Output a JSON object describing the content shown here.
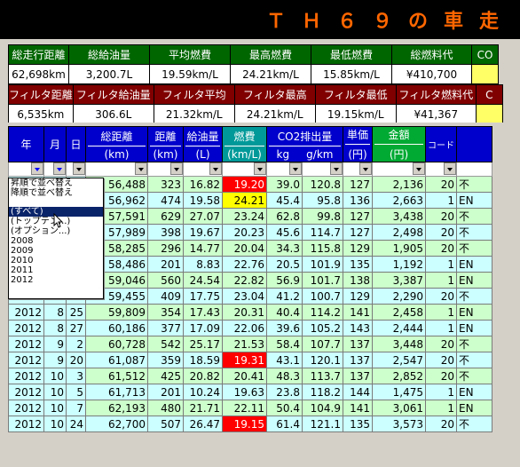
{
  "title": "ＴＨ６９の車走",
  "summary1": {
    "headers": [
      "総走行距離",
      "総給油量",
      "平均燃費",
      "最高燃費",
      "最低燃費",
      "総燃料代",
      "CO"
    ],
    "values": [
      "62,698km",
      "3,200.7L",
      "19.59km/L",
      "24.21km/L",
      "15.85km/L",
      "¥410,700",
      ""
    ]
  },
  "summary2": {
    "headers": [
      "フィルタ距離",
      "フィルタ給油量",
      "フィルタ平均",
      "フィルタ最高",
      "フィルタ最低",
      "フィルタ燃料代",
      "C"
    ],
    "values": [
      "6,535km",
      "306.6L",
      "21.32km/L",
      "24.21km/L",
      "19.15km/L",
      "¥41,367",
      ""
    ]
  },
  "headers": {
    "year": "年",
    "month": "月",
    "day": "日",
    "dist1": "総距離",
    "dist2": "(km)",
    "kyori1": "距離",
    "kyori2": "(km)",
    "fuel1": "給油量",
    "fuel2": "(L)",
    "eco1": "燃費",
    "eco2": "(km/L)",
    "co2": "CO2排出量",
    "co2a": "kg",
    "co2b": "g/km",
    "price1": "単価",
    "price2": "(円)",
    "amount1": "金額",
    "amount2": "(円)",
    "code": "コード"
  },
  "filter_popup": {
    "items": [
      "昇順で並べ替え",
      "降順で並べ替え",
      "(すべて)",
      "(トップテン...)",
      "(オプション...)",
      "2008",
      "2009",
      "2010",
      "2011",
      "2012"
    ],
    "selected_index": 2
  },
  "rows": [
    {
      "y": "",
      "m": "",
      "d": "",
      "total": "56,488",
      "dist": "323",
      "fuel": "16.82",
      "eco": "19.20",
      "kg": "39.0",
      "gkm": "120.8",
      "price": "127",
      "amt": "2,136",
      "code": "20",
      "st": "不",
      "hl": "red"
    },
    {
      "y": "",
      "m": "",
      "d": "",
      "total": "56,962",
      "dist": "474",
      "fuel": "19.58",
      "eco": "24.21",
      "kg": "45.4",
      "gkm": "95.8",
      "price": "136",
      "amt": "2,663",
      "code": "1",
      "st": "EN",
      "hl": "yel"
    },
    {
      "y": "",
      "m": "",
      "d": "",
      "total": "57,591",
      "dist": "629",
      "fuel": "27.07",
      "eco": "23.24",
      "kg": "62.8",
      "gkm": "99.8",
      "price": "127",
      "amt": "3,438",
      "code": "20",
      "st": "不",
      "hl": ""
    },
    {
      "y": "",
      "m": "",
      "d": "",
      "total": "57,989",
      "dist": "398",
      "fuel": "19.67",
      "eco": "20.23",
      "kg": "45.6",
      "gkm": "114.7",
      "price": "127",
      "amt": "2,498",
      "code": "20",
      "st": "不",
      "hl": ""
    },
    {
      "y": "",
      "m": "",
      "d": "",
      "total": "58,285",
      "dest": "",
      "dist": "296",
      "fuel": "14.77",
      "eco": "20.04",
      "kg": "34.3",
      "gkm": "115.8",
      "price": "129",
      "amt": "1,905",
      "code": "20",
      "st": "不",
      "hl": ""
    },
    {
      "y": "",
      "m": "",
      "d": "",
      "total": "58,486",
      "dist": "201",
      "fuel": "8.83",
      "eco": "22.76",
      "kg": "20.5",
      "gkm": "101.9",
      "price": "135",
      "amt": "1,192",
      "code": "1",
      "st": "EN",
      "hl": ""
    },
    {
      "y": "",
      "m": "",
      "d": "",
      "total": "59,046",
      "dist": "560",
      "fuel": "24.54",
      "eco": "22.82",
      "kg": "56.9",
      "gkm": "101.7",
      "price": "138",
      "amt": "3,387",
      "code": "1",
      "st": "EN",
      "hl": ""
    },
    {
      "y": "2012",
      "m": "8",
      "d": "15",
      "total": "59,455",
      "dist": "409",
      "fuel": "17.75",
      "eco": "23.04",
      "kg": "41.2",
      "gkm": "100.7",
      "price": "129",
      "amt": "2,290",
      "code": "20",
      "st": "不",
      "hl": ""
    },
    {
      "y": "2012",
      "m": "8",
      "d": "25",
      "total": "59,809",
      "dist": "354",
      "fuel": "17.43",
      "eco": "20.31",
      "kg": "40.4",
      "gkm": "114.2",
      "price": "141",
      "amt": "2,458",
      "code": "1",
      "st": "EN",
      "hl": ""
    },
    {
      "y": "2012",
      "m": "8",
      "d": "27",
      "total": "60,186",
      "dist": "377",
      "fuel": "17.09",
      "eco": "22.06",
      "kg": "39.6",
      "gkm": "105.2",
      "price": "143",
      "amt": "2,444",
      "code": "1",
      "st": "EN",
      "hl": ""
    },
    {
      "y": "2012",
      "m": "9",
      "d": "2",
      "total": "60,728",
      "dist": "542",
      "fuel": "25.17",
      "eco": "21.53",
      "kg": "58.4",
      "gkm": "107.7",
      "price": "137",
      "amt": "3,448",
      "code": "20",
      "st": "不",
      "hl": ""
    },
    {
      "y": "2012",
      "m": "9",
      "d": "20",
      "total": "61,087",
      "dist": "359",
      "fuel": "18.59",
      "eco": "19.31",
      "kg": "43.1",
      "gkm": "120.1",
      "price": "137",
      "amt": "2,547",
      "code": "20",
      "st": "不",
      "hl": "red"
    },
    {
      "y": "2012",
      "m": "10",
      "d": "3",
      "total": "61,512",
      "dist": "425",
      "fuel": "20.82",
      "eco": "20.41",
      "kg": "48.3",
      "gkm": "113.7",
      "price": "137",
      "amt": "2,852",
      "code": "20",
      "st": "不",
      "hl": ""
    },
    {
      "y": "2012",
      "m": "10",
      "d": "5",
      "total": "61,713",
      "dist": "201",
      "fuel": "10.24",
      "eco": "19.63",
      "kg": "23.8",
      "gkm": "118.2",
      "price": "144",
      "amt": "1,475",
      "code": "1",
      "st": "EN",
      "hl": ""
    },
    {
      "y": "2012",
      "m": "10",
      "d": "7",
      "total": "62,193",
      "dist": "480",
      "fuel": "21.71",
      "eco": "22.11",
      "kg": "50.4",
      "gkm": "104.9",
      "price": "141",
      "amt": "3,061",
      "code": "1",
      "st": "EN",
      "hl": ""
    },
    {
      "y": "2012",
      "m": "10",
      "d": "24",
      "total": "62,700",
      "dist": "507",
      "fuel": "26.47",
      "eco": "19.15",
      "kg": "61.4",
      "gkm": "121.1",
      "price": "135",
      "amt": "3,573",
      "code": "20",
      "st": "不",
      "hl": "red"
    }
  ]
}
